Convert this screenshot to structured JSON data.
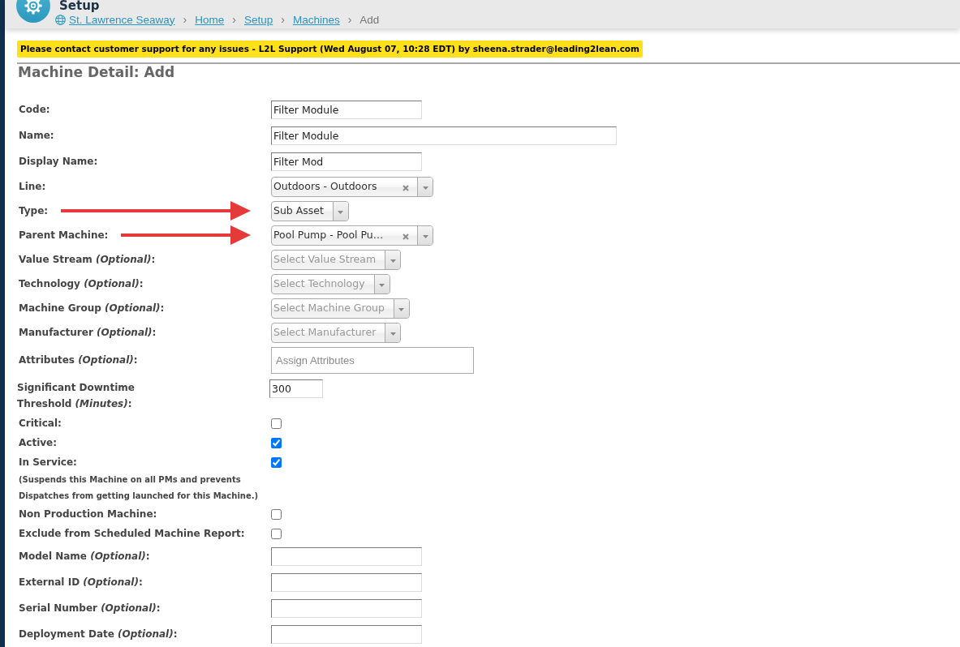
{
  "header": {
    "title": "Setup",
    "breadcrumb": [
      {
        "label": "St. Lawrence Seaway",
        "kind": "site"
      },
      {
        "label": "Home",
        "kind": "link",
        "separator_before": "›"
      },
      {
        "label": "Setup",
        "kind": "link",
        "separator_before": "›"
      },
      {
        "label": "Machines",
        "kind": "link",
        "separator_before": "›"
      },
      {
        "label": "Add",
        "kind": "current",
        "separator_before": "›"
      }
    ]
  },
  "banner": {
    "text": "Please contact customer support for any issues - L2L Support (Wed August 07, 10:28 EDT) by sheena.strader@leading2lean.com"
  },
  "heading": "Machine Detail: Add",
  "form": {
    "fields": [
      {
        "label": "Code:",
        "kind": "text",
        "value": "Filter Module",
        "annotation_arrow": false
      },
      {
        "label": "Name:",
        "kind": "long-text",
        "value": "Filter Module",
        "annotation_arrow": false
      },
      {
        "label": "Display Name:",
        "kind": "text",
        "value": "Filter Mod",
        "annotation_arrow": false
      },
      {
        "label": "Line:",
        "kind": "select",
        "value": "Outdoors - Outdoors",
        "clearable": true,
        "annotation_arrow": false
      },
      {
        "label": "Type:",
        "kind": "select",
        "value": "Sub Asset",
        "clearable": false,
        "annotation_arrow": true
      },
      {
        "label": "Parent Machine:",
        "kind": "select",
        "value": "Pool Pump - Pool Pu…",
        "clearable": true,
        "annotation_arrow": true
      },
      {
        "label": "Value Stream *(Optional)*:",
        "kind": "select",
        "placeholder": "Select Value Stream",
        "clearable": false,
        "annotation_arrow": false
      },
      {
        "label": "Technology *(Optional)*:",
        "kind": "select",
        "placeholder": "Select Technology",
        "clearable": false,
        "annotation_arrow": false
      },
      {
        "label": "Machine Group *(Optional)*:",
        "kind": "select",
        "placeholder": "Select Machine Group",
        "clearable": false,
        "annotation_arrow": false
      },
      {
        "label": "Manufacturer *(Optional)*:",
        "kind": "select",
        "placeholder": "Select Manufacturer",
        "clearable": false,
        "annotation_arrow": false
      },
      {
        "label": "Attributes *(Optional)*:",
        "kind": "tags",
        "placeholder": "Assign Attributes",
        "annotation_arrow": false
      },
      {
        "label": "Significant Downtime Threshold *(Minutes)*:",
        "kind": "number",
        "value": "300",
        "annotation_arrow": false
      },
      {
        "label": "Critical:",
        "kind": "checkbox",
        "checked": false,
        "annotation_arrow": false
      },
      {
        "label": "Active:",
        "kind": "checkbox",
        "checked": true,
        "annotation_arrow": false
      },
      {
        "label": "In Service:",
        "kind": "checkbox",
        "checked": true,
        "note": "(Suspends this Machine on all PMs and prevents Dispatches from getting launched for this Machine.)",
        "annotation_arrow": false
      },
      {
        "label": "Non Production Machine:",
        "kind": "checkbox",
        "checked": false,
        "annotation_arrow": false
      },
      {
        "label": "Exclude from Scheduled Machine Report:",
        "kind": "checkbox",
        "checked": false,
        "annotation_arrow": false
      },
      {
        "label": "Model Name *(Optional)*:",
        "kind": "text",
        "annotation_arrow": false
      },
      {
        "label": "External ID *(Optional)*:",
        "kind": "text",
        "annotation_arrow": false
      },
      {
        "label": "Serial Number *(Optional)*:",
        "kind": "text",
        "annotation_arrow": false
      },
      {
        "label": "Deployment Date *(Optional)*:",
        "kind": "text",
        "annotation_arrow": false
      }
    ]
  }
}
